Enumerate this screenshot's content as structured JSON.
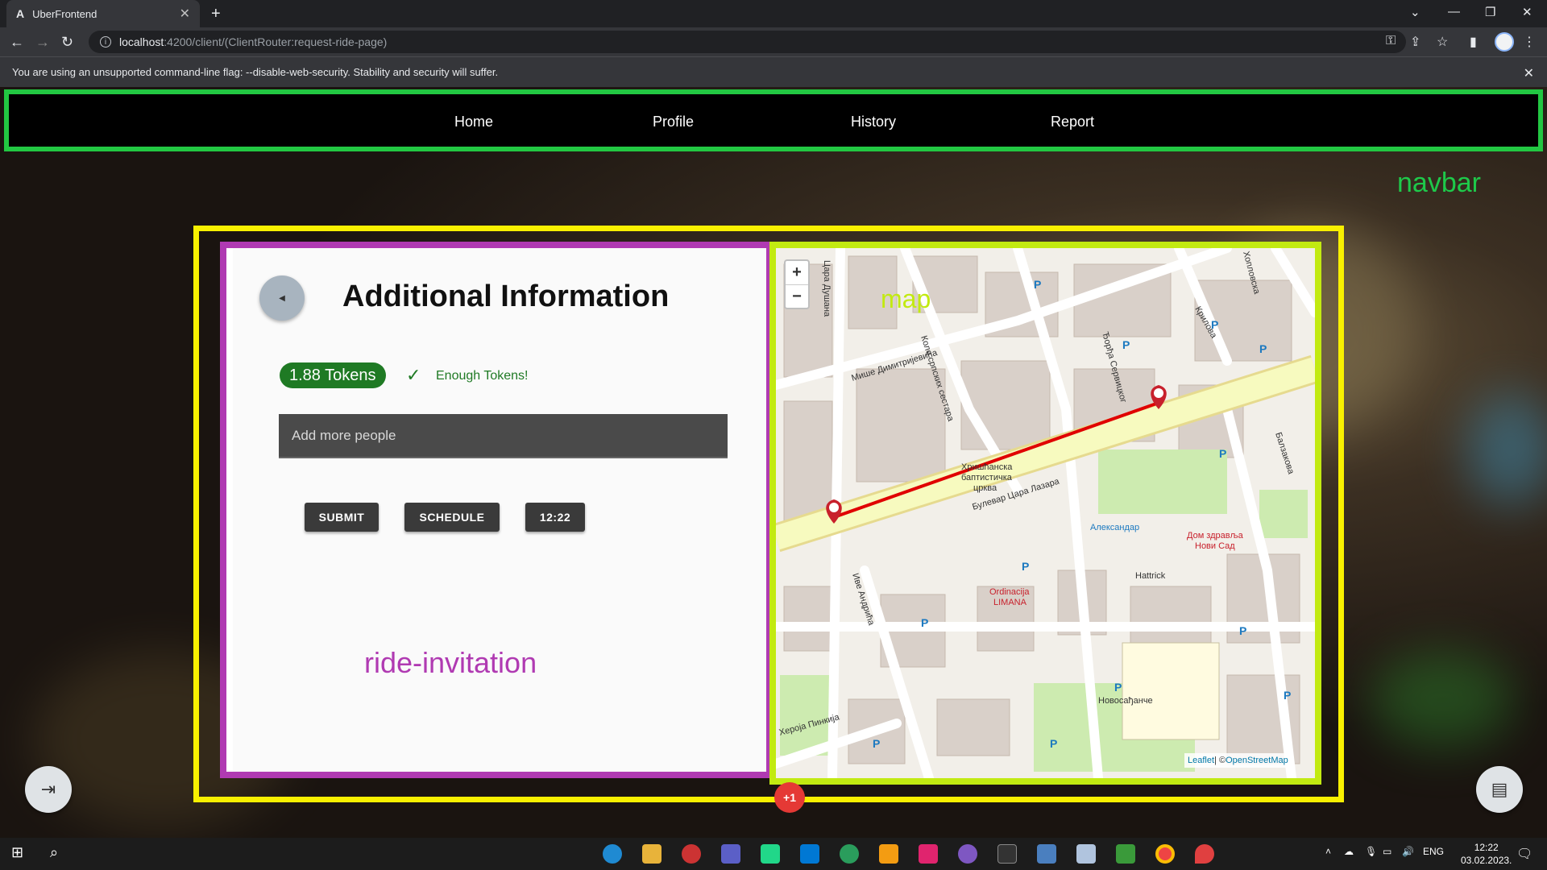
{
  "browser": {
    "tab_title": "UberFrontend",
    "tab_favicon": "A",
    "url_host": "localhost",
    "url_path": ":4200/client/(ClientRouter:request-ride-page)",
    "infobar_text": "You are using an unsupported command-line flag: --disable-web-security. Stability and security will suffer."
  },
  "navbar": {
    "links": [
      "Home",
      "Profile",
      "History",
      "Report"
    ],
    "annotation": "navbar"
  },
  "ride_invitation": {
    "title": "Additional Information",
    "tokens": "1.88 Tokens",
    "tokens_status": "Enough Tokens!",
    "people_placeholder": "Add more people",
    "buttons": [
      "SUBMIT",
      "SCHEDULE",
      "12:22"
    ],
    "annotation": "ride-invitation"
  },
  "map": {
    "annotation": "map",
    "zoom_in": "+",
    "zoom_out": "−",
    "attribution_leaflet": "Leaflet",
    "attribution_sep": " | © ",
    "attribution_osm": "OpenStreetMap",
    "street_labels": [
      "Булевар Цара Лазара",
      "Цара Душана",
      "Мише Димитријевића",
      "Коло српских сестара",
      "Ђорђа Сервицког",
      "Ive Андрића",
      "Хероја Пинкија",
      "Балзакова",
      "Крилова",
      "Хопловска",
      "Булевар Цара Лазара",
      "Александар",
      "Хрисшанска баптистичка црква",
      "Дом здравља Нови Сад",
      "Ordinacija LIMANA",
      "Hattrick",
      "Новосађанче"
    ],
    "colors": {
      "route": "#e00000",
      "marker": "#c8202c",
      "road": "#f7fabf"
    }
  },
  "page_badge": "+1",
  "taskbar": {
    "lang": "ENG",
    "time": "12:22",
    "date": "03.02.2023."
  }
}
